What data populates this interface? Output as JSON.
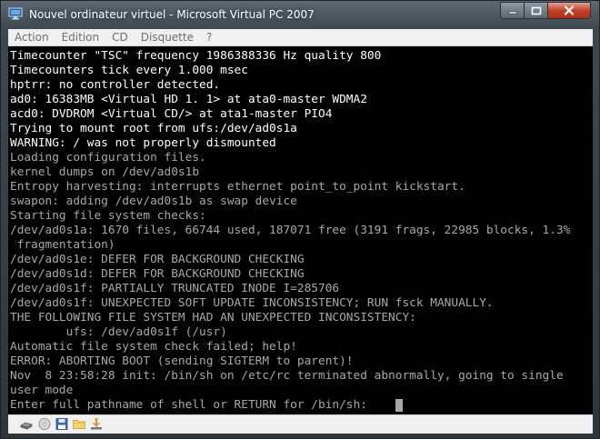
{
  "window": {
    "title": "Nouvel ordinateur virtuel - Microsoft Virtual PC 2007",
    "controls": [
      "minimize-icon",
      "maximize-icon",
      "close-icon"
    ]
  },
  "menu": {
    "items": [
      {
        "label": "Action"
      },
      {
        "label": "Edition"
      },
      {
        "label": "CD"
      },
      {
        "label": "Disquette"
      },
      {
        "label": "?"
      }
    ]
  },
  "console": {
    "lines": [
      {
        "text": "Timecounter \"TSC\" frequency 1986388336 Hz quality 800",
        "bright": true
      },
      {
        "text": "Timecounters tick every 1.000 msec",
        "bright": true
      },
      {
        "text": "hptrr: no controller detected.",
        "bright": true
      },
      {
        "text": "ad0: 16383MB <Virtual HD 1. 1> at ata0-master WDMA2",
        "bright": true
      },
      {
        "text": "acd0: DVDROM <Virtual CD/> at ata1-master PIO4",
        "bright": true
      },
      {
        "text": "Trying to mount root from ufs:/dev/ad0s1a",
        "bright": true
      },
      {
        "text": "WARNING: / was not properly dismounted",
        "bright": true
      },
      {
        "text": "Loading configuration files.",
        "bright": false
      },
      {
        "text": "kernel dumps on /dev/ad0s1b",
        "bright": false
      },
      {
        "text": "Entropy harvesting: interrupts ethernet point_to_point kickstart.",
        "bright": false
      },
      {
        "text": "swapon: adding /dev/ad0s1b as swap device",
        "bright": false
      },
      {
        "text": "Starting file system checks:",
        "bright": false
      },
      {
        "text": "/dev/ad0s1a: 1670 files, 66744 used, 187071 free (3191 frags, 22985 blocks, 1.3%",
        "bright": false
      },
      {
        "text": " fragmentation)",
        "bright": false
      },
      {
        "text": "/dev/ad0s1e: DEFER FOR BACKGROUND CHECKING",
        "bright": false
      },
      {
        "text": "/dev/ad0s1d: DEFER FOR BACKGROUND CHECKING",
        "bright": false
      },
      {
        "text": "/dev/ad0s1f: PARTIALLY TRUNCATED INODE I=285706",
        "bright": false
      },
      {
        "text": "/dev/ad0s1f: UNEXPECTED SOFT UPDATE INCONSISTENCY; RUN fsck MANUALLY.",
        "bright": false
      },
      {
        "text": "THE FOLLOWING FILE SYSTEM HAD AN UNEXPECTED INCONSISTENCY:",
        "bright": false
      },
      {
        "text": "        ufs: /dev/ad0s1f (/usr)",
        "bright": false
      },
      {
        "text": "Automatic file system check failed; help!",
        "bright": false
      },
      {
        "text": "ERROR: ABORTING BOOT (sending SIGTERM to parent)!",
        "bright": false
      },
      {
        "text": "Nov  8 23:58:28 init: /bin/sh on /etc/rc terminated abnormally, going to single",
        "bright": false
      },
      {
        "text": "user mode",
        "bright": false
      },
      {
        "text": "Enter full pathname of shell or RETURN for /bin/sh: ",
        "bright": false
      }
    ]
  },
  "statusbar": {
    "icons": [
      "hard-disk-icon",
      "cd-drive-icon",
      "floppy-disk-icon",
      "shared-folder-icon",
      "network-adapter-icon"
    ]
  },
  "colors": {
    "console_bg": "#000000",
    "console_text": "#a8a8a8",
    "console_bright": "#ffffff",
    "chrome": "#3e4850",
    "close_button": "#c0422b"
  }
}
